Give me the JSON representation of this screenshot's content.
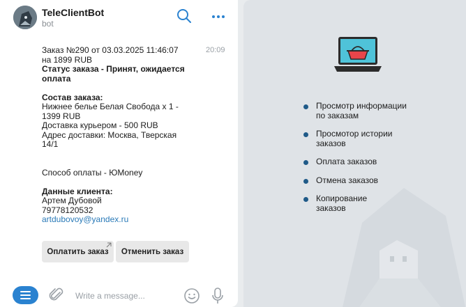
{
  "header": {
    "title": "TeleClientBot",
    "subtitle": "bot"
  },
  "message": {
    "time": "20:09",
    "order_line1": "Заказ №290 от 03.03.2025 11:46:07",
    "order_line2": "на 1899 RUB",
    "status_line1": "Статус заказа - Принят, ожидается",
    "status_line2": "оплата",
    "composition_heading": "Состав заказа:",
    "item_line1": "Нижнее белье Белая Свобода х 1 -",
    "item_line2": "1399 RUB",
    "delivery": "Доставка курьером - 500 RUB",
    "address_line1": "Адрес доставки: Москва, Тверская",
    "address_line2": "14/1",
    "payment_method": "Способ оплаты - ЮMoney",
    "client_heading": "Данные клиента:",
    "client_name": "Артем Дубовой",
    "client_phone": "79778120532",
    "client_email": "artdubovoy@yandex.ru"
  },
  "buttons": {
    "pay": "Оплатить заказ",
    "cancel": "Отменить заказ"
  },
  "composer": {
    "placeholder": "Write a message..."
  },
  "panel": {
    "features": [
      {
        "line1": "Просмотр информации",
        "line2": "по заказам"
      },
      {
        "line1": "Просмотор истории",
        "line2": "заказов"
      },
      {
        "line1": "Оплата заказов",
        "line2": ""
      },
      {
        "line1": "Отмена заказов",
        "line2": ""
      },
      {
        "line1": "Копирование",
        "line2": "заказов"
      }
    ]
  },
  "colors": {
    "accent": "#2a82d0",
    "bullet": "#1f5a88",
    "link": "#2a7ab8",
    "laptop_screen": "#4fc3d9",
    "basket": "#e8454a"
  }
}
